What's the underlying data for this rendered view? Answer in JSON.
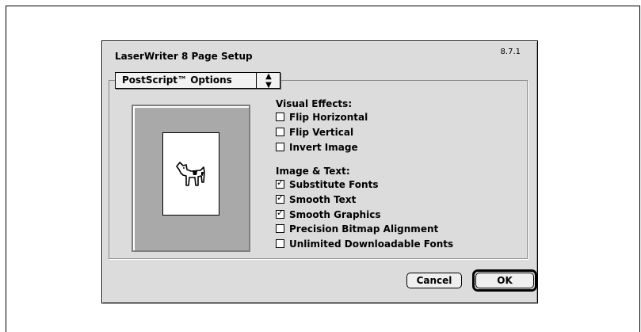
{
  "dialog": {
    "title": "LaserWriter 8 Page Setup",
    "version": "8.7.1",
    "popup": {
      "selected": "PostScript™ Options",
      "arrow": "⬍"
    },
    "visual_effects": {
      "heading": "Visual Effects:",
      "items": [
        {
          "label": "Flip Horizontal",
          "checked": false
        },
        {
          "label": "Flip Vertical",
          "checked": false
        },
        {
          "label": "Invert Image",
          "checked": false
        }
      ]
    },
    "image_text": {
      "heading": "Image & Text:",
      "items": [
        {
          "label": "Substitute Fonts",
          "checked": true
        },
        {
          "label": "Smooth Text",
          "checked": true
        },
        {
          "label": "Smooth Graphics",
          "checked": true
        },
        {
          "label": "Precision Bitmap Alignment",
          "checked": false
        },
        {
          "label": "Unlimited Downloadable Fonts",
          "checked": false
        }
      ]
    },
    "buttons": {
      "cancel": "Cancel",
      "ok": "OK"
    }
  }
}
